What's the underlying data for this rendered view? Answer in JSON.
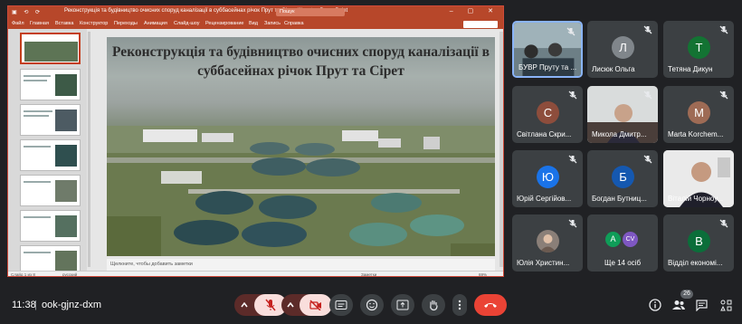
{
  "powerpoint": {
    "title": "Реконструкція та будівництво очисних споруд каналізації в суббасейнах річок Прут та Сірет (1).pptx - PowerPoint",
    "search_placeholder": "Пошук",
    "quick_access": "▣ ⟲ ⟳",
    "window_controls": "– ▢ ✕",
    "menu": [
      "Файл",
      "Главная",
      "Вставка",
      "Конструктор",
      "Переходы",
      "Анимация",
      "Слайд-шоу",
      "Рецензирование",
      "Вид",
      "Запись",
      "Справка"
    ],
    "share_label": "Поделиться",
    "slide_title": "Реконструкція та будівництво очисних споруд каналізації в суббасейнах річок Прут та Сірет",
    "notes_placeholder": "Щелкните, чтобы добавить заметки",
    "status_slide": "Слайд 1 из 8",
    "status_lang": "русский",
    "status_notes": "Заметки",
    "status_zoom": "69%",
    "thumbs": [
      {
        "n": "1"
      },
      {
        "n": "2"
      },
      {
        "n": "3"
      },
      {
        "n": "4"
      },
      {
        "n": "5"
      },
      {
        "n": "6"
      },
      {
        "n": "7"
      }
    ]
  },
  "participants": [
    {
      "name": "БУВР Пруту та ...",
      "initial": "",
      "color": "#3c4043",
      "video": true,
      "muted": true
    },
    {
      "name": "Лисюк Ольга",
      "initial": "Л",
      "color": "#80868b",
      "video": false,
      "muted": true
    },
    {
      "name": "Тетяна Дикун",
      "initial": "Т",
      "color": "#137333",
      "video": false,
      "muted": true
    },
    {
      "name": "Світлана Скри...",
      "initial": "С",
      "color": "#8d4d3c",
      "video": false,
      "muted": true
    },
    {
      "name": "Микола Дмитр...",
      "initial": "",
      "color": "#3c4043",
      "video": true,
      "muted": true
    },
    {
      "name": "Marta Korchem...",
      "initial": "M",
      "color": "#9e6b55",
      "video": false,
      "muted": true
    },
    {
      "name": "Юрій Сергійов...",
      "initial": "Ю",
      "color": "#1a73e8",
      "video": false,
      "muted": true
    },
    {
      "name": "Богдан Бутниц...",
      "initial": "Б",
      "color": "#1558b0",
      "video": false,
      "muted": true
    },
    {
      "name": "Віталій Чорноу...",
      "initial": "",
      "color": "#3c4043",
      "video": true,
      "muted": false
    },
    {
      "name": "Юлія Христин...",
      "initial": "",
      "color": "#3c4043",
      "video": false,
      "muted": true
    },
    {
      "name": "Ще 14 осіб",
      "initial": "A",
      "color": "#0f9d58",
      "video": false,
      "muted": false
    },
    {
      "name": "Відділ економі...",
      "initial": "В",
      "color": "#0b6e3a",
      "video": false,
      "muted": true
    }
  ],
  "more_second_initial": "CV",
  "bottom": {
    "time": "11:38",
    "separator": "|",
    "meeting_code": "ook-gjnz-dxm",
    "people_count": "26"
  },
  "colors": {
    "accent": "#8ab4f8",
    "end_call": "#ea4335",
    "ppt": "#b7472a",
    "bg": "#202124",
    "tile": "#3c4043"
  },
  "icons": [
    "mic-off-icon",
    "camera-off-icon",
    "captions-icon",
    "emoji-icon",
    "present-icon",
    "raise-hand-icon",
    "more-options-icon",
    "end-call-icon",
    "info-icon",
    "people-icon",
    "chat-icon",
    "activities-icon"
  ]
}
